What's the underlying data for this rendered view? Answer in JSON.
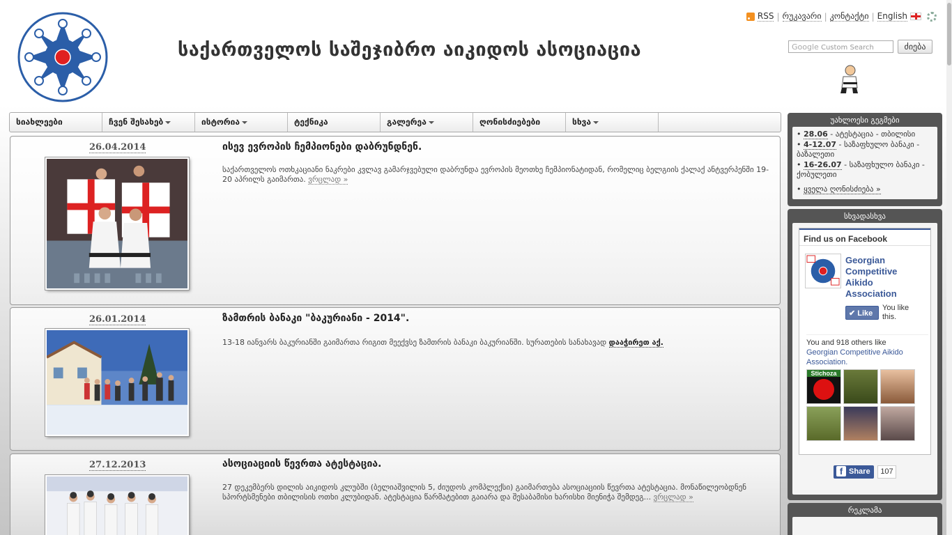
{
  "header": {
    "site_title": "საქართველოს საშეჯიბრო აიკიდოს ასოციაცია",
    "toplinks": {
      "rss": "RSS",
      "map": "რუკავარი",
      "contact": "კონტაქტი",
      "english": "English"
    },
    "search": {
      "placeholder": "Custom Search",
      "provider": "Google",
      "button_label": "ძიება"
    }
  },
  "nav": {
    "items": [
      {
        "label": "სიახლეები",
        "dropdown": false
      },
      {
        "label": "ჩვენ შესახებ",
        "dropdown": true
      },
      {
        "label": "ისტორია",
        "dropdown": true
      },
      {
        "label": "ტექნიკა",
        "dropdown": false
      },
      {
        "label": "გალერეა",
        "dropdown": true
      },
      {
        "label": "ღონისძიებები",
        "dropdown": false
      },
      {
        "label": "სხვა",
        "dropdown": true
      },
      {
        "label": "",
        "dropdown": false
      }
    ]
  },
  "posts": [
    {
      "date": "26.04.2014",
      "title": "ისევ ევროპის ჩემპიონები დაბრუნდნენ.",
      "body": "საქართველოს ოთხკაციანი ნაკრები კვლავ გამარჯვებული დაბრუნდა ევროპის მეოთხე ჩემპიონატიდან, რომელიც ბელგიის ქალაქ ანტვერპენში 19-20 აპრილს გაიმართა.",
      "more": "ვრცლად »"
    },
    {
      "date": "26.01.2014",
      "title": "ზამთრის ბანაკი \"ბაკურიანი - 2014\".",
      "body": "13-18 იანვარს ბაკურიანში გაიმართა რიგით მეექვსე ზამთრის ბანაკი ბაკურიანში. სურათების სანახავად",
      "more": "დააჭირეთ აქ."
    },
    {
      "date": "27.12.2013",
      "title": "ასოციაციის წევრთა ატესტაცია.",
      "body": "27 დეკემბერს დილის აიკიდოს კლუბში (ბელიაშვილის 5, ძიუდოს კომპლექსი) გაიმართება ასოციაციის წევრთა ატესტაცია. მონაწილეობდნენ სპორტსმენები თბილისის ოთხი კლუბიდან. ატესტაცია წარმატებით გაიარა და შესაბამისი ხარისხი მიენიჭა შემდეგ...",
      "more": "ვრცლად »"
    }
  ],
  "sidebar": {
    "events_title": "უახლოესი გეგმები",
    "events": [
      {
        "date": "28.06",
        "text": " - ატესტაცია - თბილისი"
      },
      {
        "date": "4-12.07",
        "text": " - საზაფხულო ბანაკი - ბაზალეთი"
      },
      {
        "date": "16-26.07",
        "text": " - საზაფხულო ბანაკი - ქობულეთი"
      }
    ],
    "all_events": "ყველა ღონისძიება »",
    "misc_title": "სხვადასხვა",
    "ads_title": "რეკლამა"
  },
  "facebook": {
    "header": "Find us on Facebook",
    "page_name": "Georgian Competitive Aikido Association",
    "like_label": "Like",
    "you_like": "You like this.",
    "count_text": "You and 918 others like",
    "count_link": "Georgian Competitive Aikido Association.",
    "fan_labels": [
      "Stichoza"
    ],
    "share_label": "Share",
    "share_count": "107"
  }
}
